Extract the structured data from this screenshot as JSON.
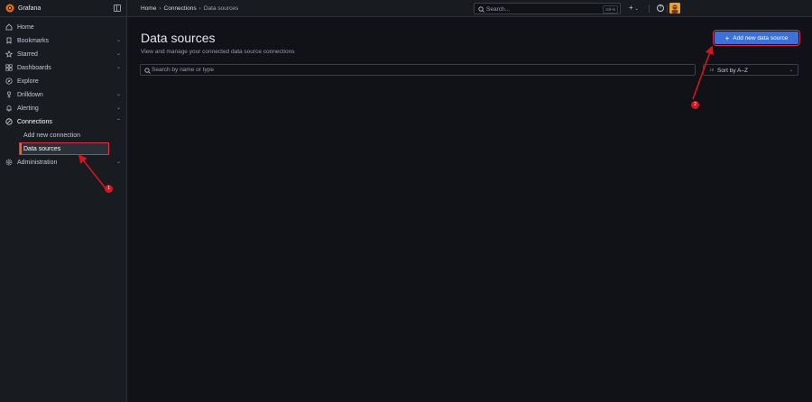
{
  "app": {
    "title": "Grafana"
  },
  "breadcrumb": {
    "home": "Home",
    "connections": "Connections",
    "current": "Data sources",
    "sep": "›"
  },
  "topbar": {
    "search_placeholder": "Search...",
    "search_shortcut": "ctrl+k",
    "new_label": "+",
    "help_label": "?"
  },
  "sidebar": {
    "items": [
      {
        "label": "Home",
        "icon": "home-icon"
      },
      {
        "label": "Bookmarks",
        "icon": "bookmark-icon",
        "chevron": "⌄"
      },
      {
        "label": "Starred",
        "icon": "star-icon",
        "chevron": "⌄"
      },
      {
        "label": "Dashboards",
        "icon": "dashboards-grid-icon",
        "chevron": "⌄"
      },
      {
        "label": "Explore",
        "icon": "compass-icon"
      },
      {
        "label": "Drilldown",
        "icon": "drilldown-icon",
        "chevron": "⌄"
      },
      {
        "label": "Alerting",
        "icon": "bell-icon",
        "chevron": "⌄"
      },
      {
        "label": "Connections",
        "icon": "connections-icon",
        "chevron": "⌃"
      },
      {
        "label": "Administration",
        "icon": "cog-icon",
        "chevron": "⌄"
      }
    ],
    "connections_sub": [
      {
        "label": "Add new connection"
      },
      {
        "label": "Data sources"
      }
    ]
  },
  "main": {
    "title": "Data sources",
    "subtitle": "View and manage your connected data source connections",
    "add_button": "Add new data source",
    "search_placeholder": "Search by name or type",
    "sort_label": "Sort by A–Z"
  },
  "annotations": {
    "badge_1": "1",
    "badge_2": "2",
    "color": "#d6151e"
  },
  "colors": {
    "primary": "#3d71d9",
    "background": "#111217",
    "panel": "#181b1f",
    "highlight": "#e02f44"
  }
}
